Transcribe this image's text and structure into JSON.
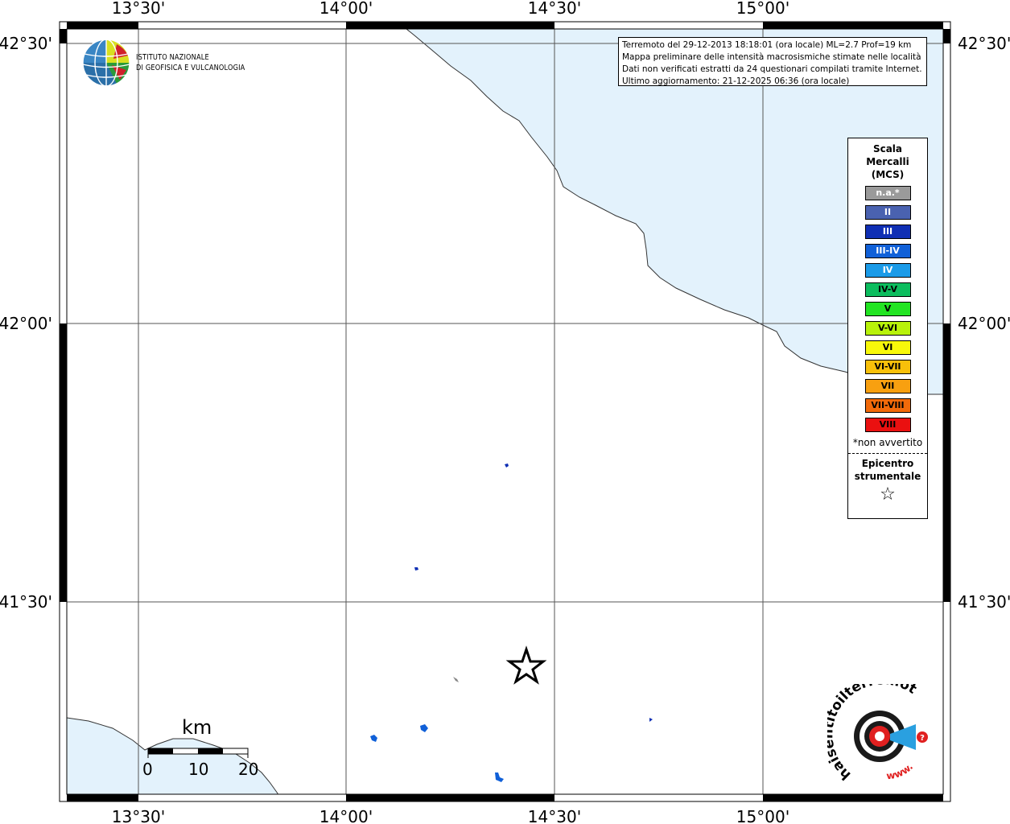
{
  "map": {
    "top_labels": [
      "13°30'",
      "14°00'",
      "14°30'",
      "15°00'"
    ],
    "bottom_labels": [
      "13°30'",
      "14°00'",
      "14°30'",
      "15°00'"
    ],
    "left_labels": [
      "42°30'",
      "42°00'",
      "41°30'"
    ],
    "right_labels": [
      "42°30'",
      "42°00'",
      "41°30'"
    ],
    "sea_color": "#e3f2fc",
    "land_color": "#ffffff",
    "epicenter_symbol": "star"
  },
  "info": {
    "line1": "Terremoto del 29-12-2013 18:18:01 (ora locale) ML=2.7 Prof=19 km",
    "line2": "Mappa preliminare delle intensità macrosismiche stimate nelle località",
    "line3": "Dati non verificati estratti da 24 questionari compilati tramite Internet.",
    "line4": "Ultimo aggiornamento: 21-12-2025 06:36 (ora locale)"
  },
  "logo": {
    "line1": "Istituto Nazionale",
    "line2": "di Geofisica e Vulcanologia"
  },
  "legend": {
    "title1": "Scala",
    "title2": "Mercalli",
    "title3": "(MCS)",
    "items": [
      {
        "label": "n.a.*",
        "color": "#9a9a9a",
        "text_color": "#ffffff"
      },
      {
        "label": "II",
        "color": "#4a62b0",
        "text_color": "#ffffff"
      },
      {
        "label": "III",
        "color": "#0f2fb4",
        "text_color": "#ffffff"
      },
      {
        "label": "III-IV",
        "color": "#1060d8",
        "text_color": "#ffffff"
      },
      {
        "label": "IV",
        "color": "#1b9be8",
        "text_color": "#ffffff"
      },
      {
        "label": "IV-V",
        "color": "#0cbd5e",
        "text_color": "#000000"
      },
      {
        "label": "V",
        "color": "#22e422",
        "text_color": "#000000"
      },
      {
        "label": "V-VI",
        "color": "#b8f20a",
        "text_color": "#000000"
      },
      {
        "label": "VI",
        "color": "#f8f80a",
        "text_color": "#000000"
      },
      {
        "label": "VI-VII",
        "color": "#f8c00a",
        "text_color": "#000000"
      },
      {
        "label": "VII",
        "color": "#f8a010",
        "text_color": "#000000"
      },
      {
        "label": "VII-VIII",
        "color": "#f26a0a",
        "text_color": "#000000"
      },
      {
        "label": "VIII",
        "color": "#ea1010",
        "text_color": "#000000"
      }
    ],
    "note": "*non avvertito",
    "epicenter1": "Epicentro",
    "epicenter2": "strumentale",
    "star": "☆"
  },
  "scale_bar": {
    "unit": "km",
    "ticks": [
      "0",
      "10",
      "20"
    ]
  },
  "hst": {
    "text_left": "haisentitoilterremoto.it",
    "text_right": "www."
  }
}
